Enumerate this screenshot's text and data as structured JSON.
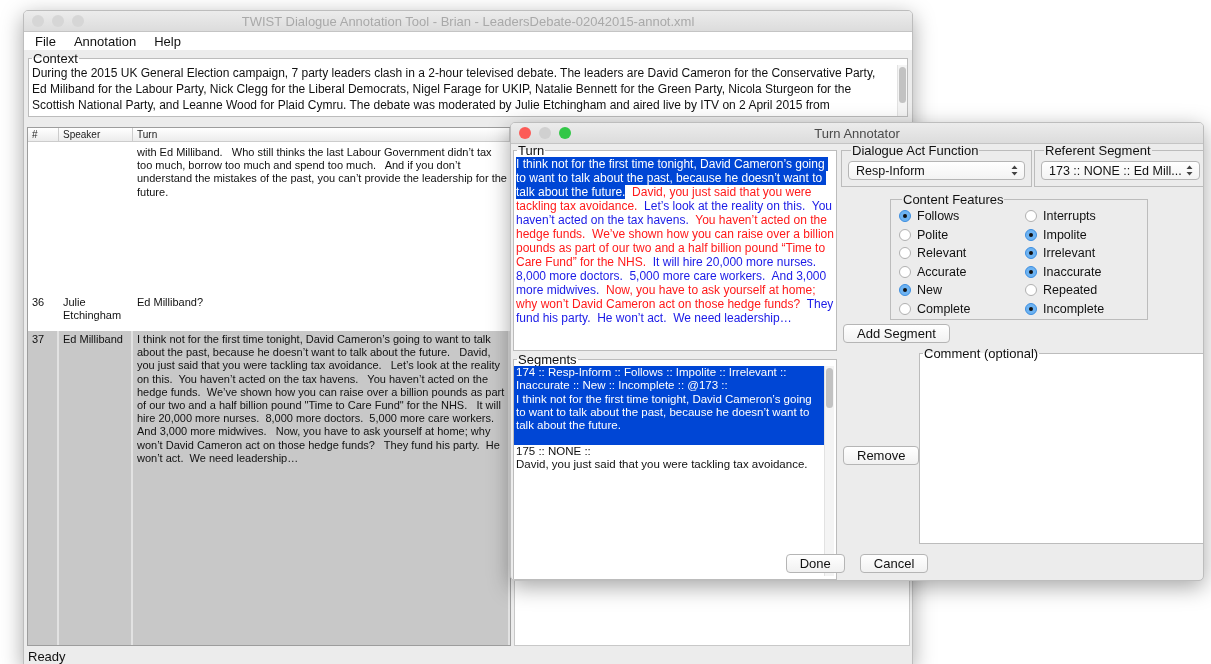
{
  "main_window": {
    "title": "TWIST Dialogue Annotation Tool - Brian - LeadersDebate-02042015-annot.xml",
    "menu": [
      "File",
      "Annotation",
      "Help"
    ],
    "context": {
      "label": "Context",
      "text": "During the 2015 UK General Election campaign, 7 party leaders clash in a 2-hour televised debate. The leaders are David Cameron for the Conservative Party, Ed Miliband for the Labour Party, Nick Clegg for the Liberal Democrats, Nigel Farage for UKIP, Natalie Bennett for the Green Party, Nicola Sturgeon for the Scottish National Party, and Leanne Wood for Plaid Cymru. The debate was moderated by Julie Etchingham and aired live by ITV on 2 April 2015 from"
    },
    "table": {
      "columns": [
        "#",
        "Speaker",
        "Turn"
      ],
      "rows": [
        {
          "turn": "with Ed Milliband.   Who still thinks the last Labour Government didn’t tax too much, borrow too much and spend too much.   And if you don’t understand the mistakes of the past, you can’t provide the leadership for the future.",
          "selected": false
        },
        {
          "number": "36",
          "speaker": "Julie Etchingham",
          "turn": "Ed Milliband?",
          "selected": false
        },
        {
          "number": "37",
          "speaker": "Ed Milliband",
          "turn": "I think not for the first time tonight, David Cameron’s going to want to talk about the past, because he doesn’t want to talk about the future.   David, you just said that you were tackling tax avoidance.   Let’s look at the reality on this.  You haven’t acted on the tax havens.   You haven’t acted on the hedge funds.  We’ve shown how you can raise over a billion pounds as part of our two and a half billion pound \"Time to Care Fund\" for the NHS.   It will hire 20,000 more nurses.  8,000 more doctors.  5,000 more care workers.  And 3,000 more midwives.   Now, you have to ask yourself at home; why won’t David Cameron act on those hedge funds?   They fund his party.  He won’t act.  We need leadership…",
          "selected": true
        }
      ]
    },
    "status_bar": "Ready"
  },
  "dialog": {
    "title": "Turn Annotator",
    "turn": {
      "label": "Turn",
      "segments": [
        {
          "text": "I think not for the first time tonight, David Cameron’s going to want to talk about the past, because he doesn’t want to talk about the future.",
          "selected": true
        },
        {
          "text": "David, you just said that you were tackling tax avoidance.",
          "color": "#ff1a1a",
          "selected": false
        },
        {
          "text": "Let’s look at the reality on this.  You haven’t acted on the tax havens.",
          "color": "#1a1ae6",
          "selected": false
        },
        {
          "text": "You haven’t acted on the hedge funds.  We’ve shown how you can raise over a billion pounds as part of our two and a half billion pound “Time to Care Fund” for the NHS.",
          "color": "#ff1a1a",
          "selected": false
        },
        {
          "text": "It will hire 20,000 more nurses.  8,000 more doctors.  5,000 more care workers.  And 3,000 more midwives.",
          "color": "#1a1ae6",
          "selected": false
        },
        {
          "text": "Now, you have to ask yourself at home; why won’t David Cameron act on those hedge funds?",
          "color": "#ff1a1a",
          "selected": false
        },
        {
          "text": "They fund his party.  He won’t act.  We need leadership…",
          "color": "#1a1ae6",
          "selected": false
        }
      ]
    },
    "segments": {
      "label": "Segments",
      "items": [
        {
          "header": "174 :: Resp-Inform :: Follows :: Impolite :: Irrelevant :: Inaccurate :: New :: Incomplete :: @173 ::",
          "text": "I think not for the first time tonight, David Cameron’s going to want to talk about the past, because he doesn’t want to talk about the future.",
          "selected": true
        },
        {
          "header": "175 :: NONE ::",
          "text": "David, you just said that you were tackling tax avoidance.",
          "selected": false
        }
      ]
    },
    "dialogue_act_function": {
      "label": "Dialogue Act Function",
      "value": "Resp-Inform"
    },
    "referent_segment": {
      "label": "Referent Segment",
      "value": "173 :: NONE ::  Ed Mill..."
    },
    "content_features": {
      "label": "Content Features",
      "options": [
        {
          "label": "Follows",
          "checked": true
        },
        {
          "label": "Interrupts",
          "checked": false
        },
        {
          "label": "Polite",
          "checked": false
        },
        {
          "label": "Impolite",
          "checked": true
        },
        {
          "label": "Relevant",
          "checked": false
        },
        {
          "label": "Irrelevant",
          "checked": true
        },
        {
          "label": "Accurate",
          "checked": false
        },
        {
          "label": "Inaccurate",
          "checked": true
        },
        {
          "label": "New",
          "checked": true
        },
        {
          "label": "Repeated",
          "checked": false
        },
        {
          "label": "Complete",
          "checked": false
        },
        {
          "label": "Incomplete",
          "checked": true
        }
      ]
    },
    "add_segment_button": "Add Segment",
    "remove_button": "Remove",
    "comment": {
      "label": "Comment (optional)"
    },
    "buttons": [
      "Done",
      "Cancel"
    ]
  }
}
